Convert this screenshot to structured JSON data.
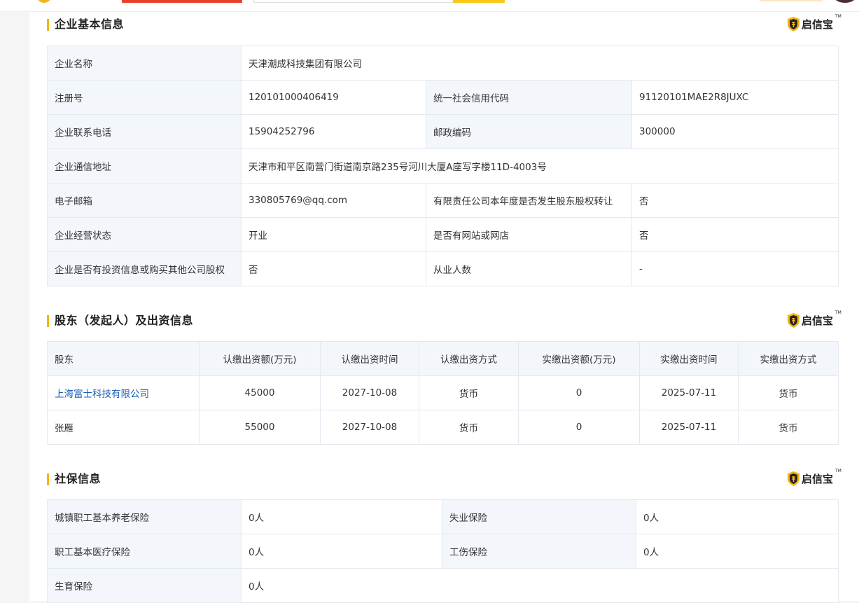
{
  "brand": {
    "name": "启信宝",
    "tm": "TM"
  },
  "basic": {
    "title": "企业基本信息",
    "company_name": {
      "label": "企业名称",
      "value": "天津潮成科技集团有限公司"
    },
    "reg_no": {
      "label": "注册号",
      "value": "120101000406419"
    },
    "credit_code": {
      "label": "统一社会信用代码",
      "value": "91120101MAE2R8JUXC"
    },
    "phone": {
      "label": "企业联系电话",
      "value": "15904252796"
    },
    "postcode": {
      "label": "邮政编码",
      "value": "300000"
    },
    "address": {
      "label": "企业通信地址",
      "value": "天津市和平区南营门街道南京路235号河川大厦A座写字楼11D-4003号"
    },
    "email": {
      "label": "电子邮箱",
      "value": "330805769@qq.com"
    },
    "equity_transfer": {
      "label": "有限责任公司本年度是否发生股东股权转让",
      "value": "否"
    },
    "status": {
      "label": "企业经营状态",
      "value": "开业"
    },
    "website": {
      "label": "是否有网站或网店",
      "value": "否"
    },
    "investment": {
      "label": "企业是否有投资信息或购买其他公司股权",
      "value": "否"
    },
    "employees": {
      "label": "从业人数",
      "value": "-"
    }
  },
  "shareholders": {
    "title": "股东（发起人）及出资信息",
    "columns": [
      "股东",
      "认缴出资额(万元)",
      "认缴出资时间",
      "认缴出资方式",
      "实缴出资额(万元)",
      "实缴出资时间",
      "实缴出资方式"
    ],
    "rows": [
      [
        "上海富士科技有限公司",
        "45000",
        "2027-10-08",
        "货币",
        "0",
        "2025-07-11",
        "货币"
      ],
      [
        "张雁",
        "55000",
        "2027-10-08",
        "货币",
        "0",
        "2025-07-11",
        "货币"
      ]
    ]
  },
  "social": {
    "title": "社保信息",
    "pension": {
      "label": "城镇职工基本养老保险",
      "value": "0人"
    },
    "unemployment": {
      "label": "失业保险",
      "value": "0人"
    },
    "medical": {
      "label": "职工基本医疗保险",
      "value": "0人"
    },
    "injury": {
      "label": "工伤保险",
      "value": "0人"
    },
    "maternity": {
      "label": "生育保险",
      "value": "0人"
    }
  },
  "colors": {
    "accent": "#f3b515",
    "link": "#1a5fb4",
    "label_bg": "#f3f7fc",
    "border": "#e4e8ef"
  }
}
